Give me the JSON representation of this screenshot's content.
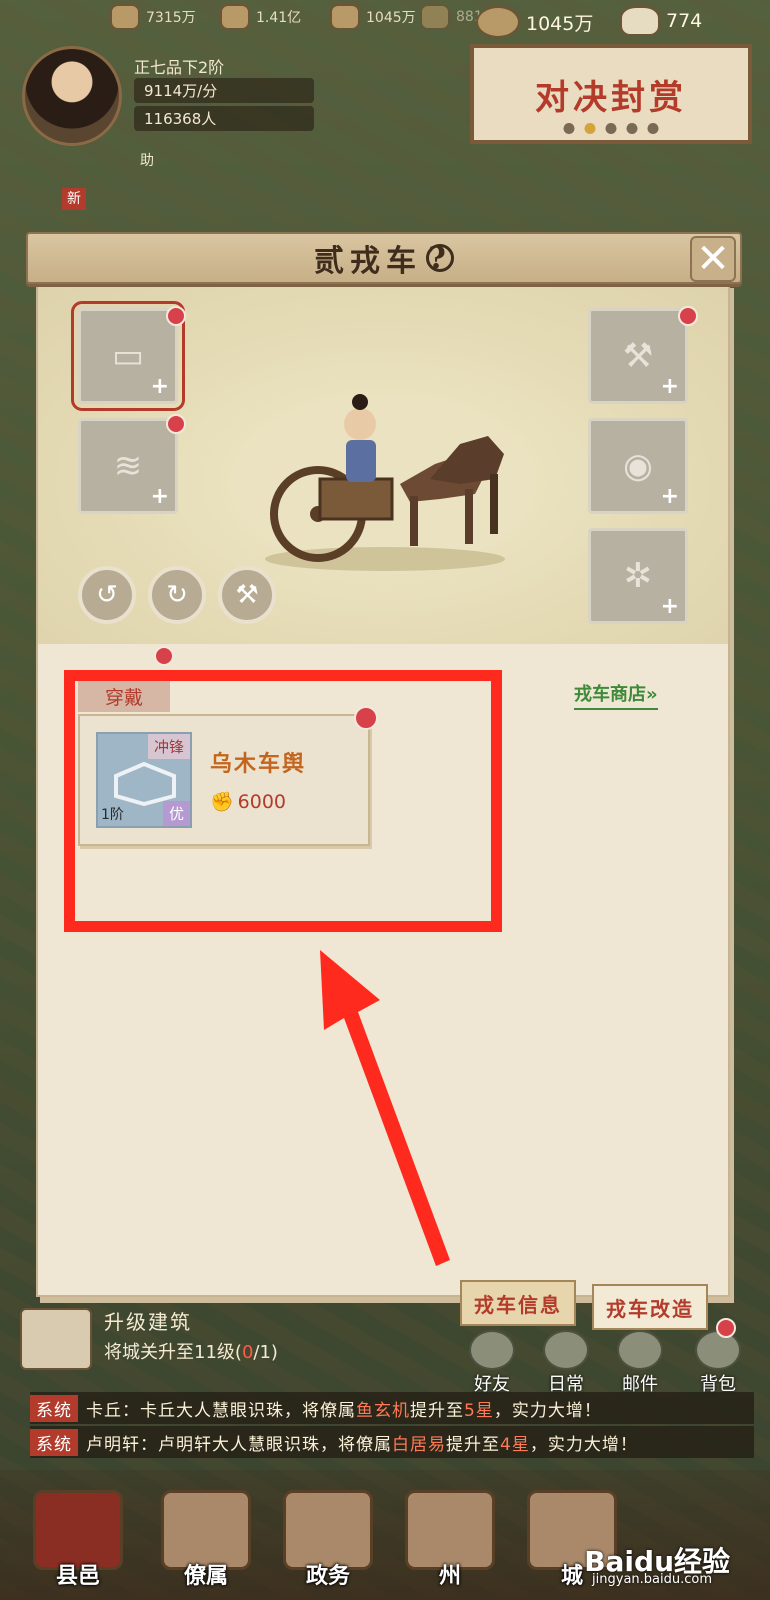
{
  "top": {
    "res1": "7315万",
    "res2": "1.41亿",
    "res3": "1045万",
    "res4": "881.",
    "coins": "1045万",
    "ingots": "774"
  },
  "player": {
    "rank": "正七品下2阶",
    "income": "9114万/分",
    "population": "116368人",
    "helper": "助",
    "new_badge": "新"
  },
  "reward_banner": "对决封赏",
  "panel": {
    "title": "贰戎车",
    "help": "?",
    "close": "✕",
    "equip_tag": "穿戴",
    "shop_link": "戎车商店»",
    "card": {
      "type": "冲锋",
      "grade": "优",
      "tier": "1阶",
      "name": "乌木车舆",
      "power": "6000"
    },
    "tabs": [
      "戎车信息",
      "戎车改造"
    ]
  },
  "quest": {
    "title": "升级建筑",
    "desc_prefix": "将城关升至11级(",
    "desc_progress": "0",
    "desc_suffix": "/1)"
  },
  "side_buttons": [
    "好友",
    "日常",
    "邮件",
    "背包"
  ],
  "system_messages": [
    {
      "tag": "系统",
      "text1": "卡丘：卡丘大人慧眼识珠，将僚属",
      "name": "鱼玄机",
      "text2": "提升至",
      "stars": "5星",
      "text3": "，实力大增！"
    },
    {
      "tag": "系统",
      "text1": "卢明轩：卢明轩大人慧眼识珠，将僚属",
      "name": "白居易",
      "text2": "提升至",
      "stars": "4星",
      "text3": "，实力大增！"
    }
  ],
  "nav": [
    "县邑",
    "僚属",
    "政务",
    "州",
    "城"
  ],
  "watermark": "Baidu经验",
  "watermark_sub": "jingyan.baidu.com",
  "colors": {
    "accent_red": "#ff2a1e",
    "title_red": "#b23b2b",
    "shop_green": "#3e8a3a"
  }
}
